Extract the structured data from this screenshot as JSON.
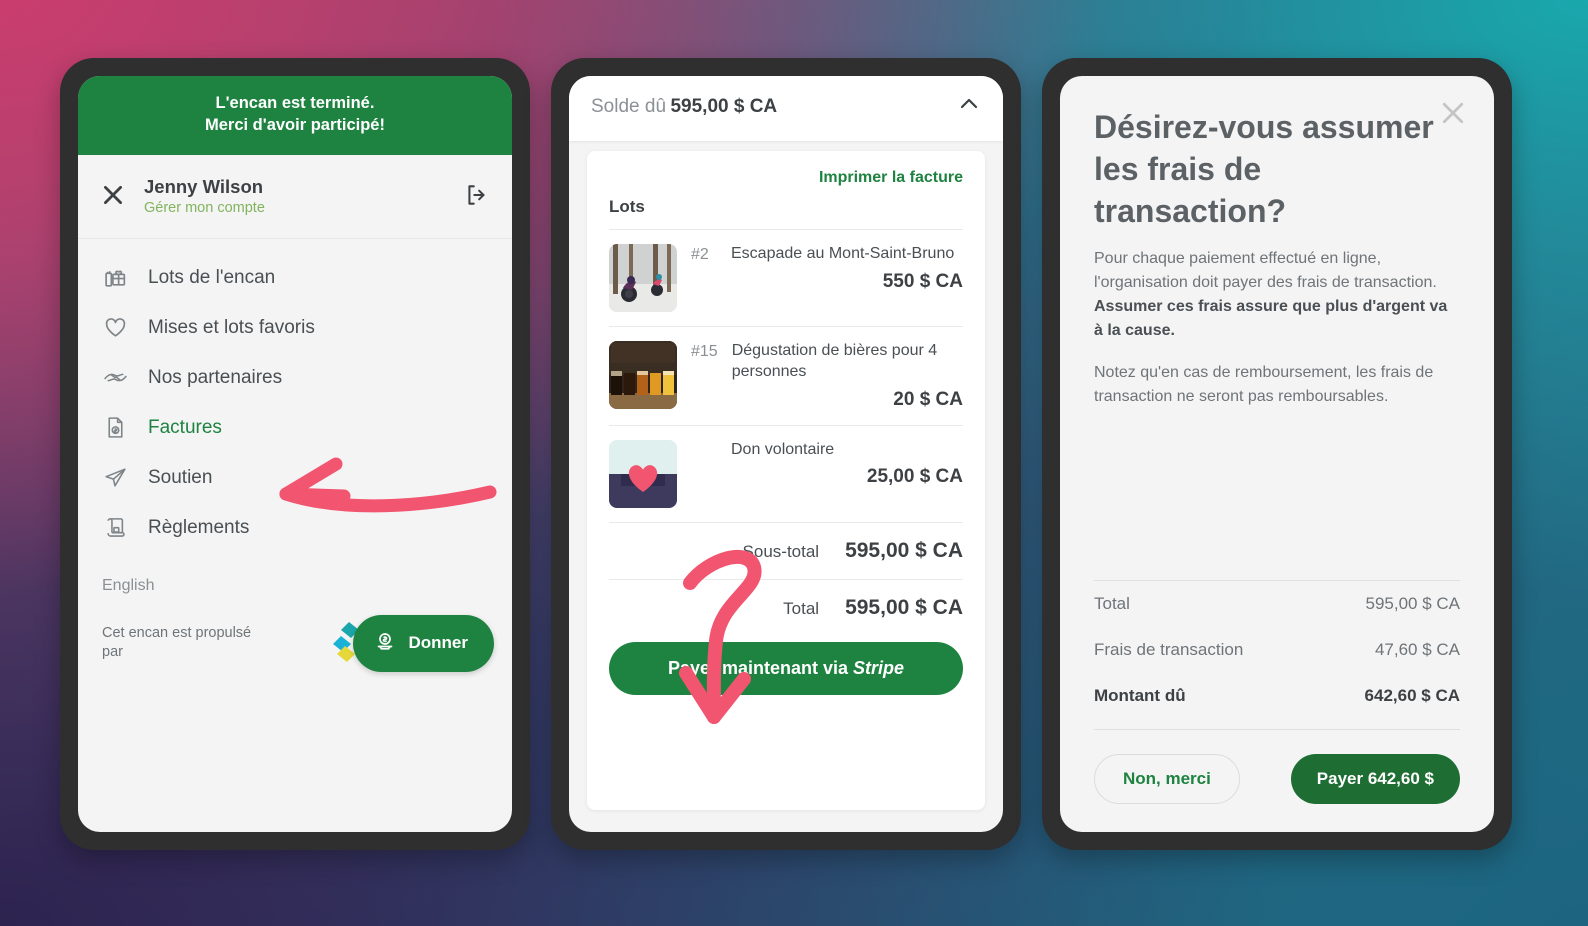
{
  "theme": {
    "green": "#1e8340",
    "green_dark": "#1e6e33",
    "accent_pink": "#f2556f",
    "frame": "#2f2f2f",
    "panel_bg": "#f4f4f4"
  },
  "left_panel": {
    "banner_line1": "L'encan est terminé.",
    "banner_line2": "Merci d'avoir participé!",
    "account": {
      "close_icon": "close-icon",
      "name": "Jenny Wilson",
      "subtitle": "Gérer mon compte",
      "logout_icon": "logout-icon"
    },
    "menu": [
      {
        "label": "Lots de l'encan",
        "icon": "gift-icon",
        "active": false
      },
      {
        "label": "Mises et lots favoris",
        "icon": "heart-icon",
        "active": false
      },
      {
        "label": "Nos partenaires",
        "icon": "handshake-icon",
        "active": false
      },
      {
        "label": "Factures",
        "icon": "invoice-icon",
        "active": true
      },
      {
        "label": "Soutien",
        "icon": "send-icon",
        "active": false
      },
      {
        "label": "Règlements",
        "icon": "scroll-icon",
        "active": false
      }
    ],
    "language": "English",
    "powered_by": "Cet encan est propulsé par",
    "donate_button": "Donner",
    "donate_icon": "money-icon"
  },
  "middle_panel": {
    "balance_label": "Solde dû",
    "balance_amount": "595,00 $ CA",
    "collapse_icon": "chevron-up-icon",
    "print_link": "Imprimer la facture",
    "lots_heading": "Lots",
    "lots": [
      {
        "number": "#2",
        "name": "Escapade au Mont-Saint-Bruno",
        "price": "550 $ CA",
        "thumb": "winter-cycling-photo"
      },
      {
        "number": "#15",
        "name": "Dégustation de bières pour 4 personnes",
        "price": "20 $ CA",
        "thumb": "beer-flight-photo"
      },
      {
        "number": "",
        "name": "Don volontaire",
        "price": "25,00 $ CA",
        "thumb": "heart-donation-icon"
      }
    ],
    "subtotal_label": "Sous-total",
    "subtotal_value": "595,00 $ CA",
    "total_label": "Total",
    "total_value": "595,00 $ CA",
    "pay_button_prefix": "Payer maintenant via ",
    "pay_button_brand": "Stripe"
  },
  "right_panel": {
    "close_icon": "close-icon",
    "title": "Désirez-vous assumer les frais de transaction?",
    "paragraph1_plain": "Pour chaque paiement effectué en ligne, l'organisation doit payer des frais de transaction. ",
    "paragraph1_bold": "Assumer ces frais assure que plus d'argent va à la cause.",
    "paragraph2": "Notez qu'en cas de remboursement, les frais de transaction ne seront pas remboursables.",
    "summary": [
      {
        "label": "Total",
        "value": "595,00 $ CA",
        "bold": false
      },
      {
        "label": "Frais de transaction",
        "value": "47,60 $ CA",
        "bold": false
      },
      {
        "label": "Montant dû",
        "value": "642,60 $ CA",
        "bold": true
      }
    ],
    "decline_button": "Non, merci",
    "accept_button": "Payer 642,60 $"
  },
  "annotations": [
    {
      "name": "arrow-to-factures",
      "color": "#f2556f"
    },
    {
      "name": "arrow-to-total",
      "color": "#f2556f"
    }
  ]
}
